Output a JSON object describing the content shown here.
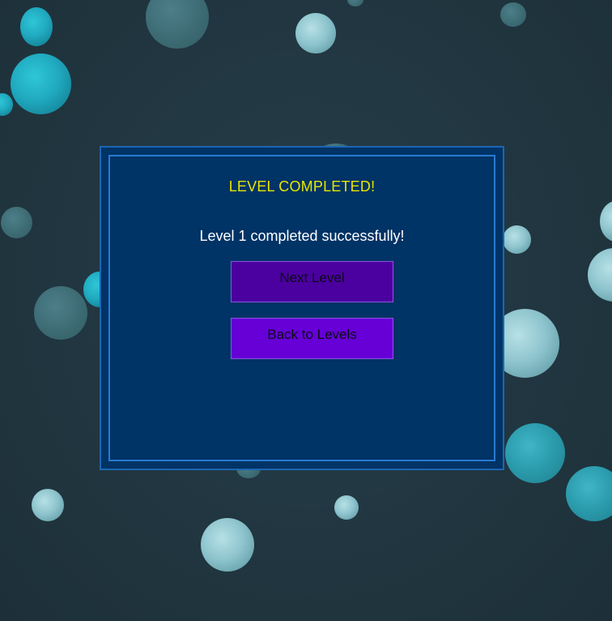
{
  "dialog": {
    "title": "LEVEL COMPLETED!",
    "message": "Level 1 completed successfully!",
    "next_label": "Next Level",
    "back_label": "Back to Levels"
  },
  "colors": {
    "background": "#223640",
    "dialog_bg": "#003366",
    "dialog_border": "#1c66b3",
    "title": "#e6e600",
    "message": "#ffffff",
    "next_button": "#4b00a0",
    "back_button": "#6600d6"
  }
}
